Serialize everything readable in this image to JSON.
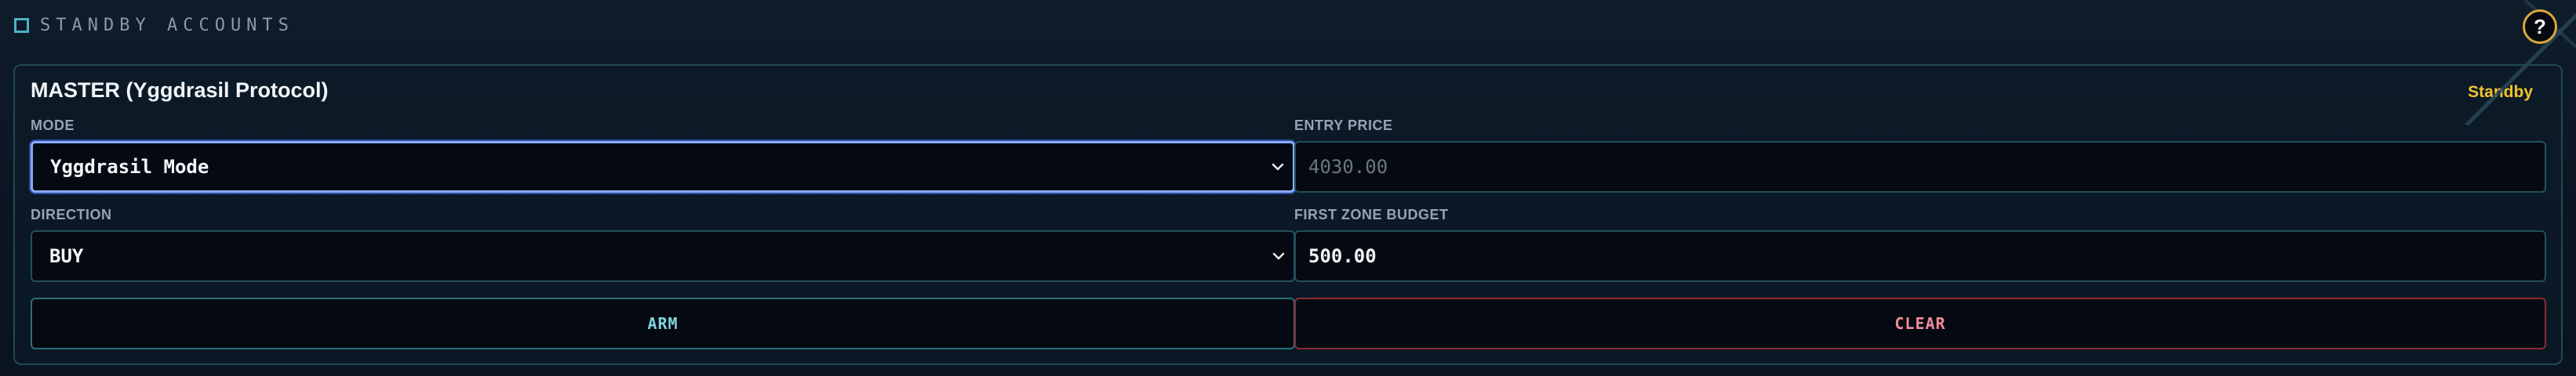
{
  "section": {
    "title": "STANDBY ACCOUNTS"
  },
  "help": {
    "label": "?"
  },
  "card": {
    "title": "MASTER (Yggdrasil Protocol)",
    "status": "Standby",
    "mode": {
      "label": "MODE",
      "selected": "Yggdrasil Mode"
    },
    "entry_price": {
      "label": "ENTRY PRICE",
      "placeholder": "4030.00"
    },
    "direction": {
      "label": "DIRECTION",
      "selected": "BUY"
    },
    "first_zone_budget": {
      "label": "FIRST ZONE BUDGET",
      "value": "500.00"
    },
    "arm_label": "ARM",
    "clear_label": "CLEAR"
  },
  "colors": {
    "accent_cyan": "#4fb0c6",
    "status_yellow": "#f2c230",
    "danger_red": "#8c2b35",
    "focus_blue": "#8aa9ff"
  }
}
